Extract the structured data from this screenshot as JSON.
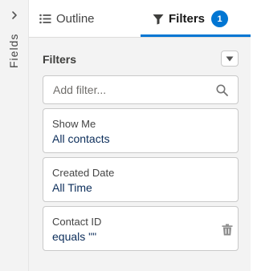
{
  "rail": {
    "label": "Fields",
    "chevron_icon": "chevron-right-icon"
  },
  "tabs": {
    "outline": {
      "label": "Outline",
      "icon": "list-icon"
    },
    "filters": {
      "label": "Filters",
      "icon": "filter-icon",
      "badge": "1"
    }
  },
  "panel": {
    "title": "Filters",
    "menu_icon": "chevron-down-icon",
    "search": {
      "placeholder": "Add filter...",
      "value": "",
      "icon": "search-icon"
    },
    "filters": [
      {
        "label": "Show Me",
        "value": "All contacts"
      },
      {
        "label": "Created Date",
        "value": "All Time"
      },
      {
        "label": "Contact ID",
        "value": "equals \"\"",
        "remove_icon": "trash-icon"
      }
    ]
  },
  "colors": {
    "accent": "#0176d3",
    "panel_bg": "#f3f3f3",
    "border": "#c9c9c9"
  }
}
